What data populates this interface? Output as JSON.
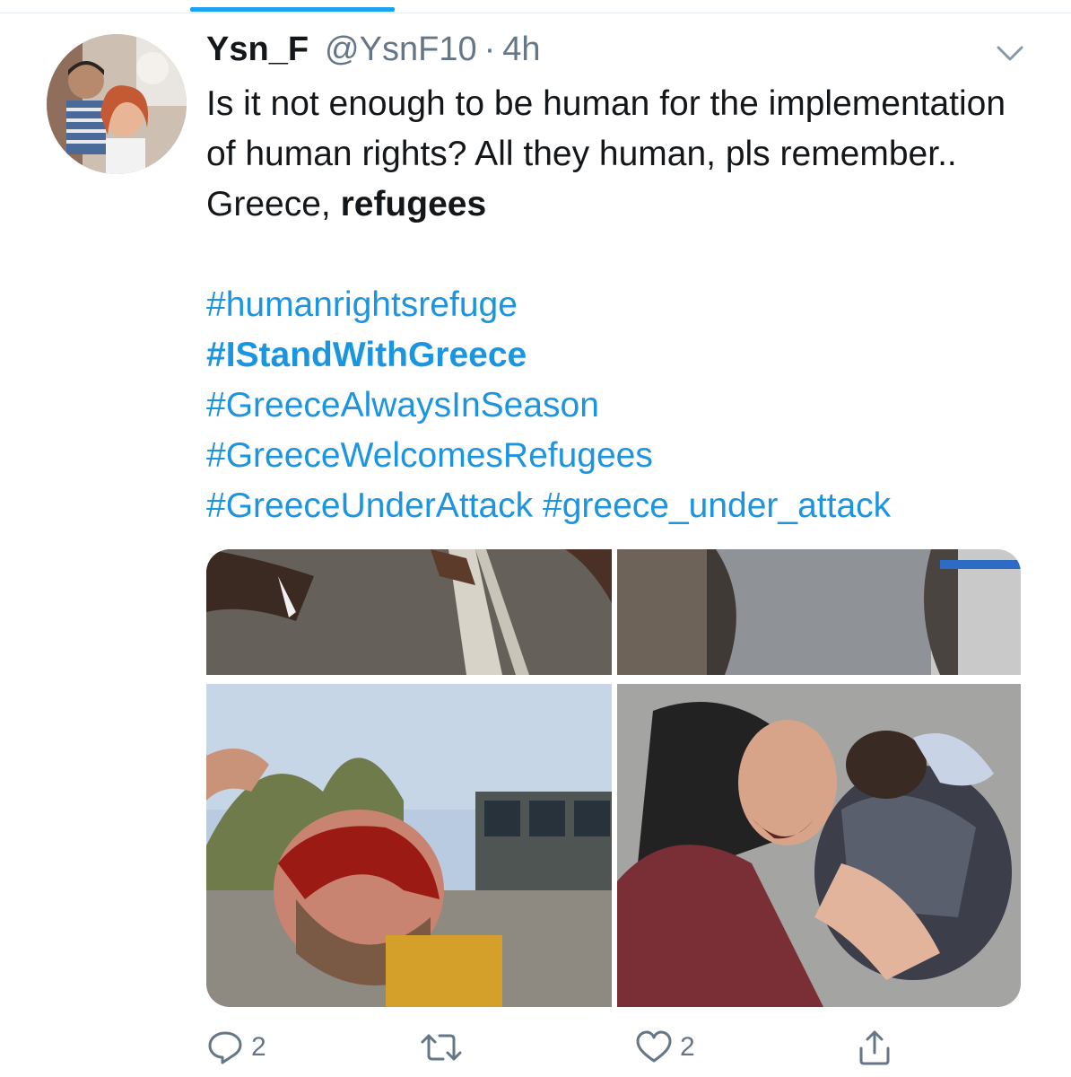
{
  "tweet": {
    "author_name": "Ysn_F",
    "handle": "@YsnF10",
    "separator": "·",
    "time": "4h",
    "text_plain": "Is it not enough to be human for the implementation of human rights? All they human, pls remember.. Greece,",
    "text_bold": "refugees",
    "hashtags": {
      "h1": "#humanrightsrefuge",
      "h2": "#IStandWithGreece",
      "h3": "#GreeceAlwaysInSeason",
      "h4": "#GreeceWelcomesRefugees",
      "h5a": "#GreeceUnderAttack",
      "h5b": "#greece_under_attack"
    }
  },
  "actions": {
    "reply_count": "2",
    "like_count": "2"
  },
  "colors": {
    "accent": "#1da1f2",
    "link": "#1b95e0",
    "muted": "#657786"
  },
  "icons": [
    "chevron-down-icon",
    "reply-icon",
    "retweet-icon",
    "like-icon",
    "share-icon"
  ]
}
